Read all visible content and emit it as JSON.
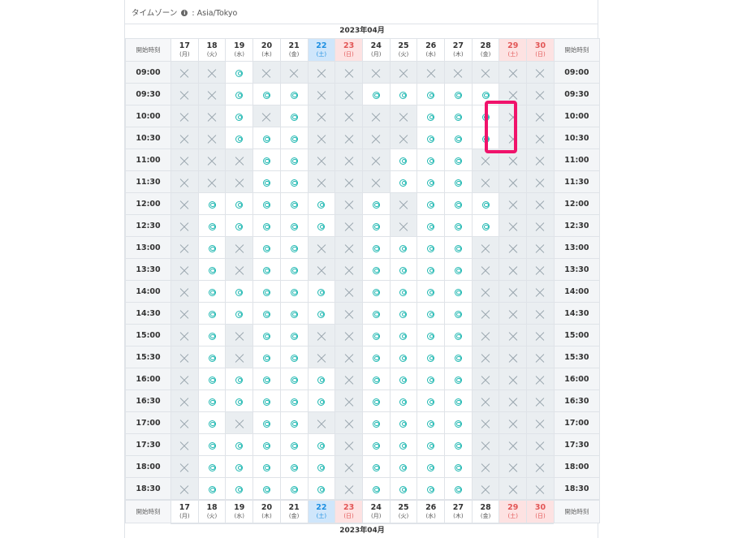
{
  "timezone": {
    "label": "タイムゾーン",
    "info_icon": "info-icon",
    "value": "Asia/Tokyo"
  },
  "month_label": "2023年04月",
  "start_time_label": "開始時刻",
  "days": [
    {
      "date": "17",
      "weekday": "(月)",
      "type": "weekday"
    },
    {
      "date": "18",
      "weekday": "(火)",
      "type": "weekday"
    },
    {
      "date": "19",
      "weekday": "(水)",
      "type": "weekday"
    },
    {
      "date": "20",
      "weekday": "(木)",
      "type": "weekday"
    },
    {
      "date": "21",
      "weekday": "(金)",
      "type": "weekday"
    },
    {
      "date": "22",
      "weekday": "(土)",
      "type": "sat"
    },
    {
      "date": "23",
      "weekday": "(日)",
      "type": "sun"
    },
    {
      "date": "24",
      "weekday": "(月)",
      "type": "weekday"
    },
    {
      "date": "25",
      "weekday": "(火)",
      "type": "weekday"
    },
    {
      "date": "26",
      "weekday": "(水)",
      "type": "weekday"
    },
    {
      "date": "27",
      "weekday": "(木)",
      "type": "weekday"
    },
    {
      "date": "28",
      "weekday": "(金)",
      "type": "weekday"
    },
    {
      "date": "29",
      "weekday": "(土)",
      "type": "sun"
    },
    {
      "date": "30",
      "weekday": "(日)",
      "type": "sun"
    }
  ],
  "slot_legend": {
    "o": "available (double-circle-icon)",
    "x": "unavailable (cross-icon)"
  },
  "rows": [
    {
      "time": "09:00",
      "slots": "xxoxxxxxxxxxxx"
    },
    {
      "time": "09:30",
      "slots": "xxoooxxoooooxx"
    },
    {
      "time": "10:00",
      "slots": "xxoxoxxxxoooxx"
    },
    {
      "time": "10:30",
      "slots": "xxoooxxxxoooxx"
    },
    {
      "time": "11:00",
      "slots": "xxxooxxxoooxxx"
    },
    {
      "time": "11:30",
      "slots": "xxxooxxxoooxxx"
    },
    {
      "time": "12:00",
      "slots": "xoooooxoxoooxx"
    },
    {
      "time": "12:30",
      "slots": "xoooooxoxoooxx"
    },
    {
      "time": "13:00",
      "slots": "xoxooxxooooxxx"
    },
    {
      "time": "13:30",
      "slots": "xoxooxxooooxxx"
    },
    {
      "time": "14:00",
      "slots": "xoooooxooooxxx"
    },
    {
      "time": "14:30",
      "slots": "xoooooxooooxxx"
    },
    {
      "time": "15:00",
      "slots": "xoxooxxooooxxx"
    },
    {
      "time": "15:30",
      "slots": "xoxooxxooooxxx"
    },
    {
      "time": "16:00",
      "slots": "xoooooxooooxxx"
    },
    {
      "time": "16:30",
      "slots": "xoooooxooooxxx"
    },
    {
      "time": "17:00",
      "slots": "xoxooxxooooxxx"
    },
    {
      "time": "17:30",
      "slots": "xoooooxooooxxx"
    },
    {
      "time": "18:00",
      "slots": "xoooooxooooxxx"
    },
    {
      "time": "18:30",
      "slots": "xoooooxooooxxx"
    }
  ],
  "highlight_color": "#f0136b",
  "colors": {
    "available": "#20b8b2",
    "unavailable_bg": "#eaeef1",
    "saturday": "#1d8fe1",
    "sunday": "#e25656"
  }
}
